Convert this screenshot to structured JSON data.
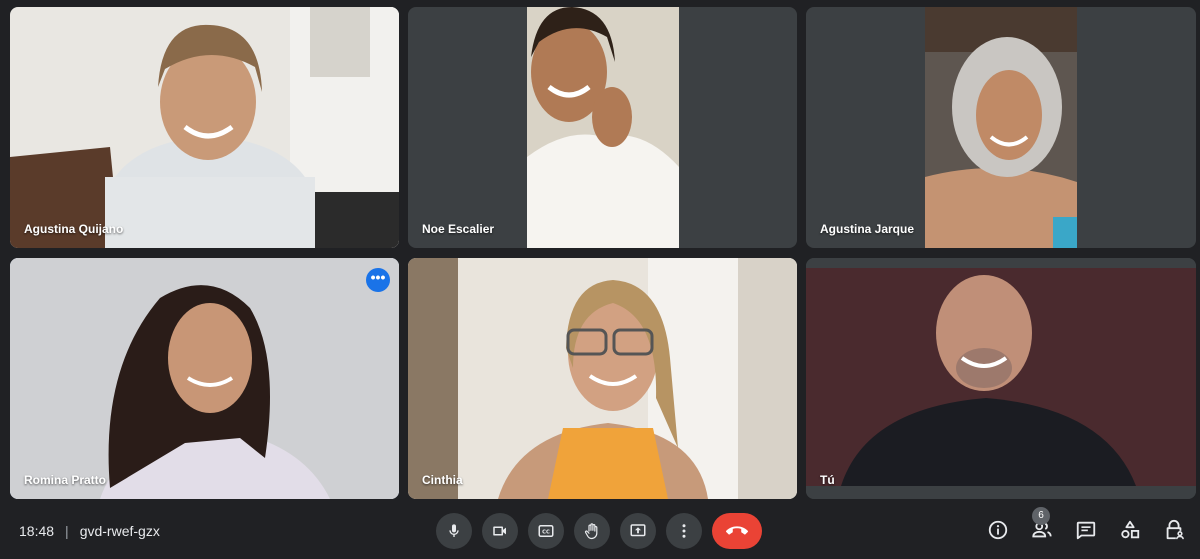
{
  "participants": [
    {
      "name": "Agustina Quijano"
    },
    {
      "name": "Noe Escalier"
    },
    {
      "name": "Agustina Jarque"
    },
    {
      "name": "Romina Pratto"
    },
    {
      "name": "Cinthia"
    },
    {
      "name": "Tú"
    }
  ],
  "active_tile_menu": "•••",
  "footer": {
    "time": "18:48",
    "separator": "|",
    "meeting_code": "gvd-rwef-gzx"
  },
  "people_count": "6",
  "icons": {
    "mic": "mic-icon",
    "camera": "camera-icon",
    "captions": "captions-icon",
    "raise_hand": "hand-icon",
    "present": "present-screen-icon",
    "more": "more-vert-icon",
    "hangup": "phone-hangup-icon",
    "info": "info-icon",
    "people": "people-icon",
    "chat": "chat-icon",
    "activities": "activities-icon",
    "host_controls": "lock-person-icon"
  },
  "colors": {
    "background": "#202124",
    "tile": "#3c4043",
    "active_outline": "#8ab4f8",
    "hangup": "#ea4335",
    "accent": "#1a73e8"
  }
}
